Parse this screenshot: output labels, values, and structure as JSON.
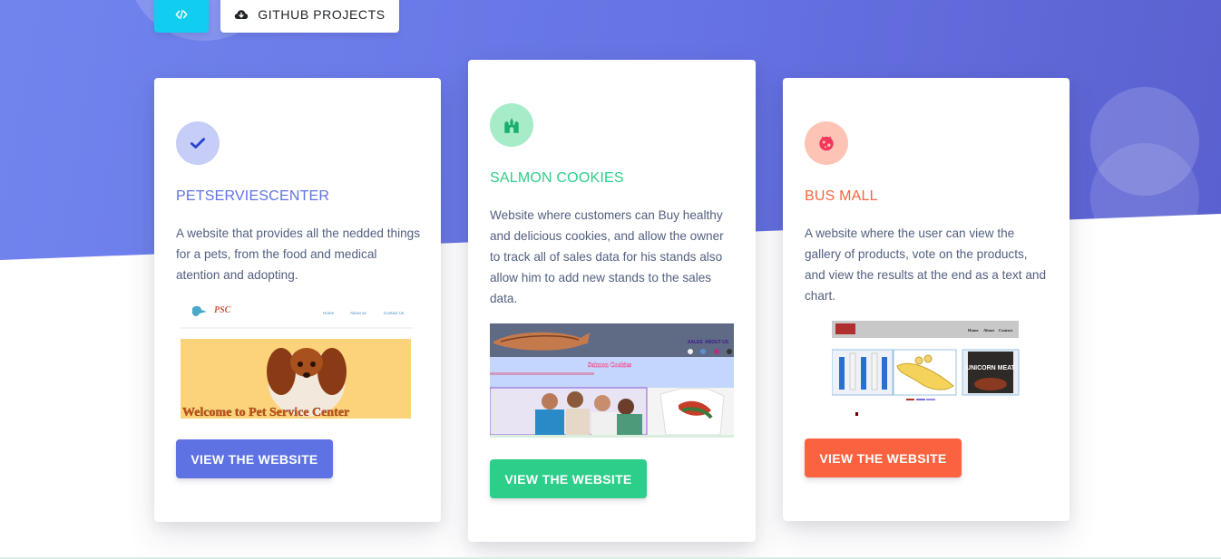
{
  "header": {
    "code_button_icon": "code-icon",
    "github_button": {
      "icon": "cloud-download-icon",
      "label": "GITHUB PROJECTS"
    }
  },
  "colors": {
    "primary": "#5e72e4",
    "success": "#2dce89",
    "warning": "#fb6340",
    "info": "#11cdef"
  },
  "cards": [
    {
      "icon": "check-icon",
      "title": "PETSERVIESCENTER",
      "description": "A website that provides all the nedded things for a pets, from the food and medical atention and adopting.",
      "screenshot": {
        "logo": "PSC",
        "nav": [
          "Home",
          "About us",
          "Contact Us"
        ],
        "banner": "Welcome to Pet Service Center"
      },
      "button": "VIEW THE WEBSITE"
    },
    {
      "icon": "castle-icon",
      "title": "SALMON COOKIES",
      "description": "Website where customers can Buy healthy and delicious cookies, and allow the owner to track all of sales data for his stands also allow him to add new stands to the sales data.",
      "screenshot": {
        "nav": [
          "SALES",
          "ABOUT US"
        ],
        "banner": "Salmon Cookies"
      },
      "button": "VIEW THE WEBSITE"
    },
    {
      "icon": "bug-icon",
      "title": "BUS MALL",
      "description": "A website where the user can view the gallery of products, vote on the products, and view the results at the end as a text and chart.",
      "screenshot": {
        "nav": [
          "Home",
          "About",
          "Contact"
        ],
        "product_label": "UNICORN MEAT"
      },
      "button": "VIEW THE WEBSITE"
    }
  ]
}
